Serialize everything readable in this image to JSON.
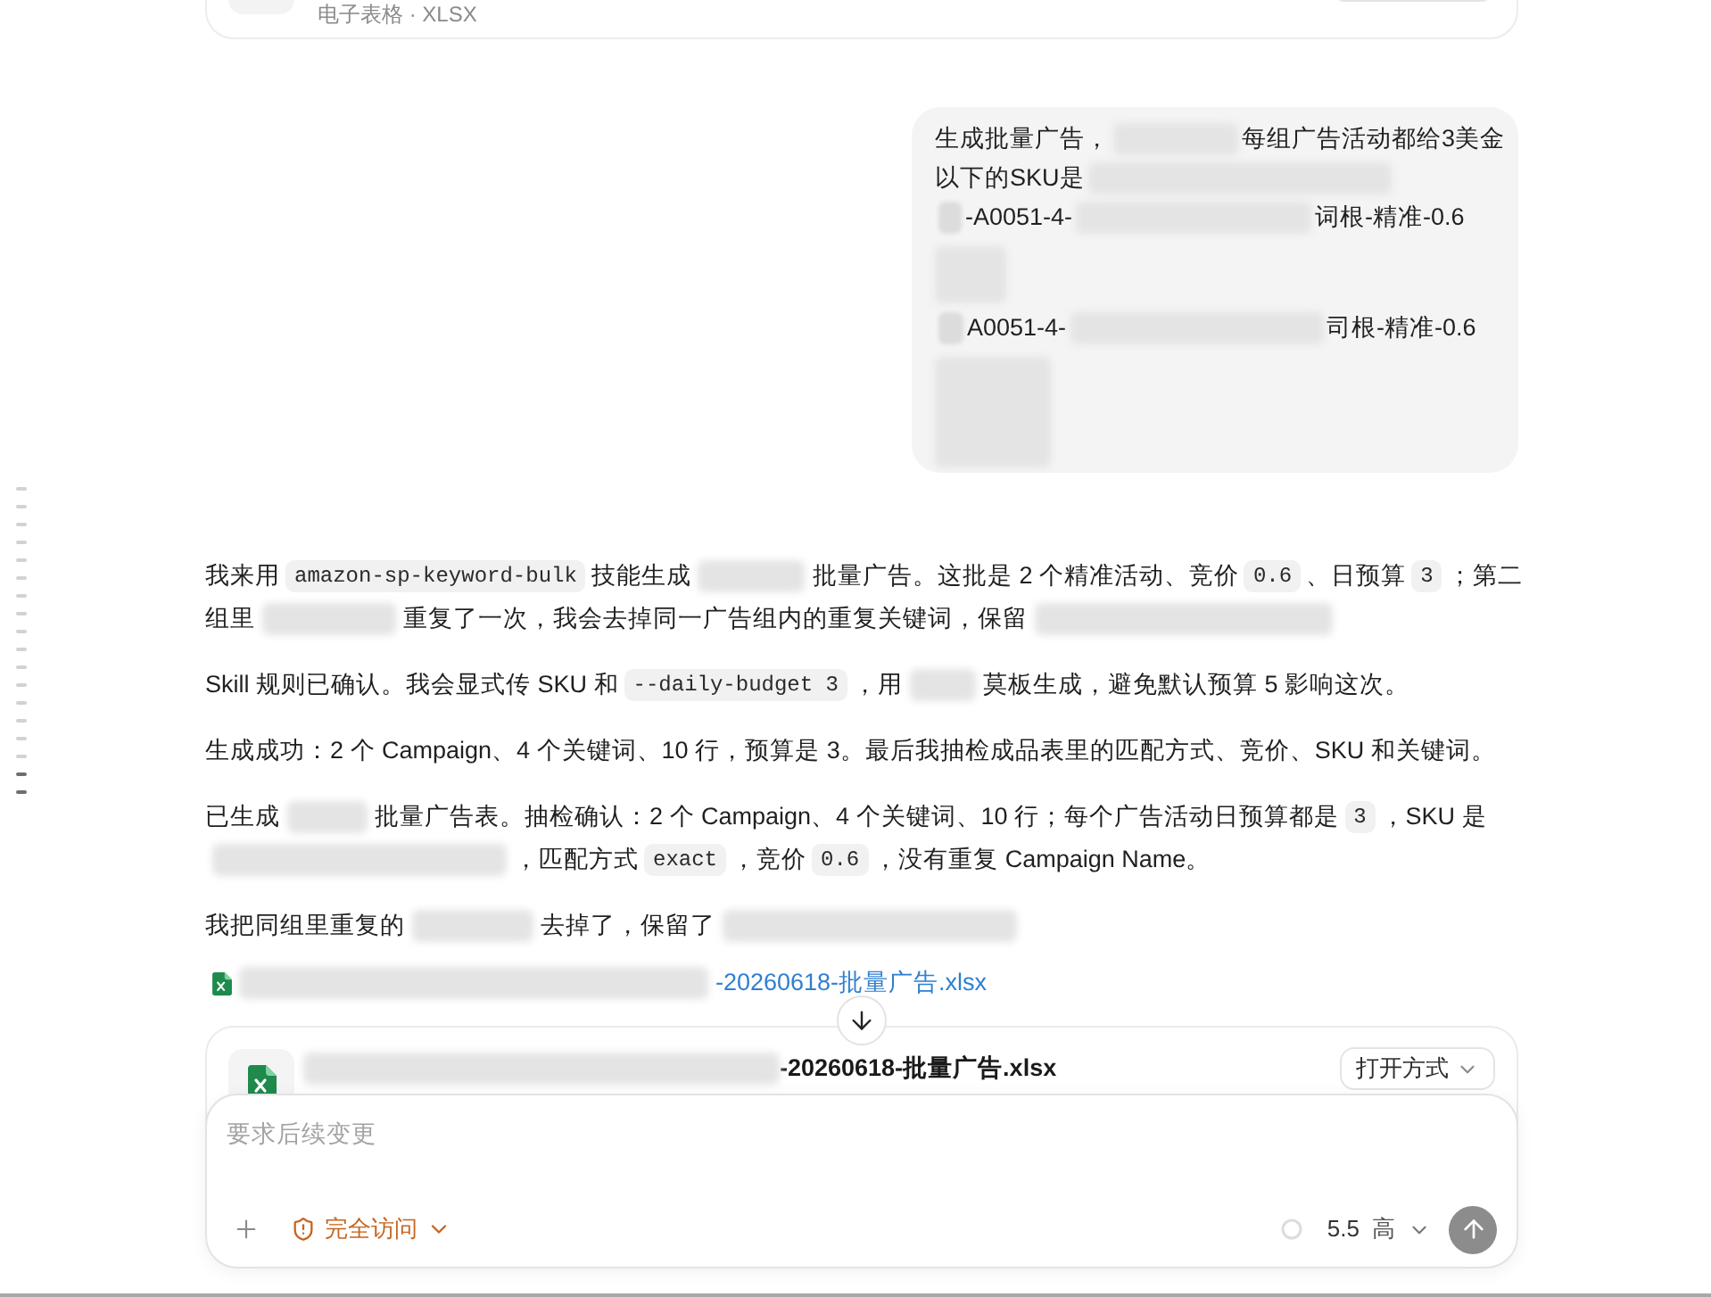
{
  "top_file_card": {
    "subtitle": "电子表格 · XLSX"
  },
  "user_message": {
    "lines": [
      [
        {
          "kind": "text",
          "text": "生成批量广告，"
        },
        {
          "kind": "redacted"
        },
        {
          "kind": "text",
          "text": "每组广告活动都给3美金"
        }
      ],
      [
        {
          "kind": "text",
          "text": "以下的SKU是"
        },
        {
          "kind": "redacted"
        }
      ],
      [
        {
          "kind": "redacted"
        },
        {
          "kind": "text",
          "text": "-A0051-4-"
        },
        {
          "kind": "redacted"
        },
        {
          "kind": "text",
          "text": "词根-精准-0.6"
        }
      ],
      [
        {
          "kind": "redacted"
        }
      ],
      [
        {
          "kind": "redacted"
        },
        {
          "kind": "text",
          "text": "A0051-4-"
        },
        {
          "kind": "redacted"
        },
        {
          "kind": "text",
          "text": "司根-精准-0.6"
        }
      ],
      [
        {
          "kind": "redacted"
        }
      ]
    ]
  },
  "assistant_paragraphs": [
    {
      "lines": [
        [
          {
            "kind": "text",
            "text": "我来用"
          },
          {
            "kind": "code",
            "text": "amazon-sp-keyword-bulk"
          },
          {
            "kind": "text",
            "text": "技能生成"
          },
          {
            "kind": "redacted"
          },
          {
            "kind": "text",
            "text": "批量广告。这批是 2 个精准活动、竞价"
          },
          {
            "kind": "code",
            "text": "0.6"
          },
          {
            "kind": "text",
            "text": "、日预算"
          },
          {
            "kind": "code",
            "text": "3"
          },
          {
            "kind": "text",
            "text": "；第二"
          }
        ],
        [
          {
            "kind": "text",
            "text": "组里"
          },
          {
            "kind": "redacted"
          },
          {
            "kind": "text",
            "text": "重复了一次，我会去掉同一广告组内的重复关键词，保留"
          },
          {
            "kind": "redacted"
          }
        ]
      ]
    },
    {
      "lines": [
        [
          {
            "kind": "text",
            "text": "Skill 规则已确认。我会显式传 SKU 和"
          },
          {
            "kind": "code",
            "text": "--daily-budget 3"
          },
          {
            "kind": "text",
            "text": "，用"
          },
          {
            "kind": "redacted"
          },
          {
            "kind": "text",
            "text": "莫板生成，避免默认预算 5 影响这次。"
          }
        ]
      ]
    },
    {
      "lines": [
        [
          {
            "kind": "text",
            "text": "生成成功：2 个 Campaign、4 个关键词、10 行，预算是 3。最后我抽检成品表里的匹配方式、竞价、SKU 和关键词。"
          }
        ]
      ]
    },
    {
      "lines": [
        [
          {
            "kind": "text",
            "text": "已生成"
          },
          {
            "kind": "redacted"
          },
          {
            "kind": "text",
            "text": "批量广告表。抽检确认：2 个 Campaign、4 个关键词、10 行；每个广告活动日预算都是"
          },
          {
            "kind": "code",
            "text": "3"
          },
          {
            "kind": "text",
            "text": "，SKU 是"
          }
        ],
        [
          {
            "kind": "redacted"
          },
          {
            "kind": "text",
            "text": "，匹配方式"
          },
          {
            "kind": "code",
            "text": "exact"
          },
          {
            "kind": "text",
            "text": "，竞价"
          },
          {
            "kind": "code",
            "text": "0.6"
          },
          {
            "kind": "text",
            "text": "，没有重复 Campaign Name。"
          }
        ]
      ]
    },
    {
      "lines": [
        [
          {
            "kind": "text",
            "text": "我把同组里重复的"
          },
          {
            "kind": "redacted"
          },
          {
            "kind": "text",
            "text": "去掉了，保留了"
          },
          {
            "kind": "redacted"
          }
        ]
      ]
    }
  ],
  "file_link": {
    "text": "-20260618-批量广告.xlsx",
    "redacted_prefix": true
  },
  "file_card": {
    "title": "-20260618-批量广告.xlsx",
    "redacted_prefix": true,
    "open_button": "打开方式"
  },
  "composer": {
    "placeholder": "要求后续变更",
    "access_label": "完全访问",
    "model": "5.5",
    "effort": "高",
    "send_disabled": true
  },
  "timeline_markers": [
    {
      "selected": false
    },
    {
      "selected": false
    },
    {
      "selected": false
    },
    {
      "selected": false
    },
    {
      "selected": false
    },
    {
      "selected": false
    },
    {
      "selected": false
    },
    {
      "selected": false
    },
    {
      "selected": false
    },
    {
      "selected": false
    },
    {
      "selected": false
    },
    {
      "selected": false
    },
    {
      "selected": false
    },
    {
      "selected": false
    },
    {
      "selected": false
    },
    {
      "selected": false
    },
    {
      "selected": true
    },
    {
      "selected": true
    }
  ]
}
